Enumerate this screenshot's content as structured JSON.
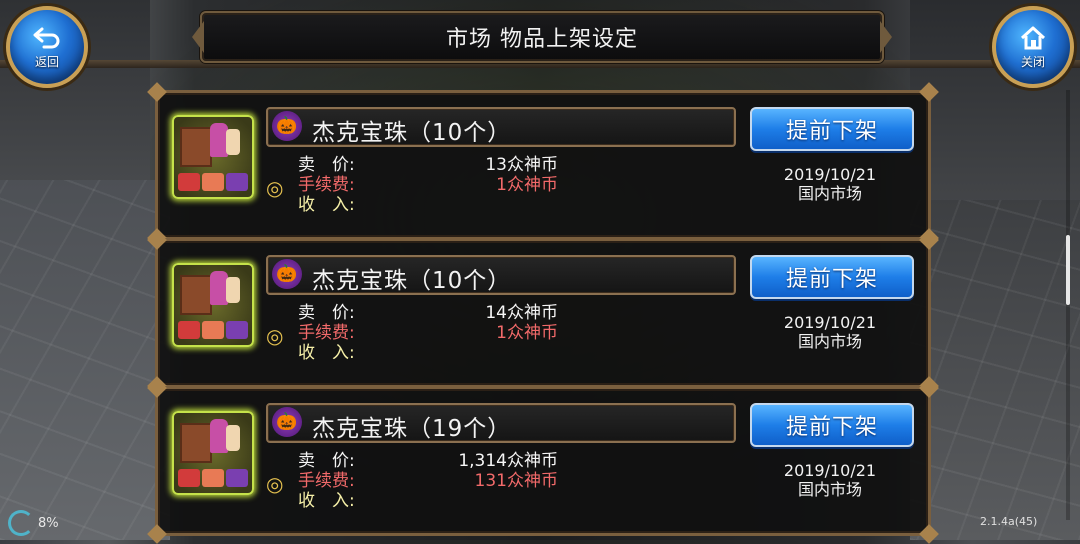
{
  "header": {
    "title": "市场 物品上架设定",
    "back_label": "返回",
    "close_label": "关闭"
  },
  "listings": [
    {
      "name": "杰克宝珠（10个）",
      "unlist_label": "提前下架",
      "sale_label": "卖　价:",
      "fee_label": "手续费:",
      "income_label": "收　入:",
      "sale_value": "13众神币",
      "fee_value": "1众神币",
      "date": "2019/10/21",
      "market": "国内市场"
    },
    {
      "name": "杰克宝珠（10个）",
      "unlist_label": "提前下架",
      "sale_label": "卖　价:",
      "fee_label": "手续费:",
      "income_label": "收　入:",
      "sale_value": "14众神币",
      "fee_value": "1众神币",
      "date": "2019/10/21",
      "market": "国内市场"
    },
    {
      "name": "杰克宝珠（19个）",
      "unlist_label": "提前下架",
      "sale_label": "卖　价:",
      "fee_label": "手续费:",
      "income_label": "收　入:",
      "sale_value": "1,314众神币",
      "fee_value": "131众神币",
      "date": "2019/10/21",
      "market": "国内市场"
    }
  ],
  "status": {
    "battery": "8%",
    "version": "2.1.4a(45)"
  },
  "colors": {
    "sale_text": "#f6f6f6",
    "fee_text": "#f26a6a",
    "income_text": "#f6f0a8",
    "button_blue": "#1e7ee8",
    "frame_gold": "#7a5f3e"
  },
  "icons": {
    "back": "back-arrow-icon",
    "close": "home-icon",
    "item": "market-stall-icon",
    "badge": "pumpkin-icon",
    "coins": "coins-icon"
  }
}
